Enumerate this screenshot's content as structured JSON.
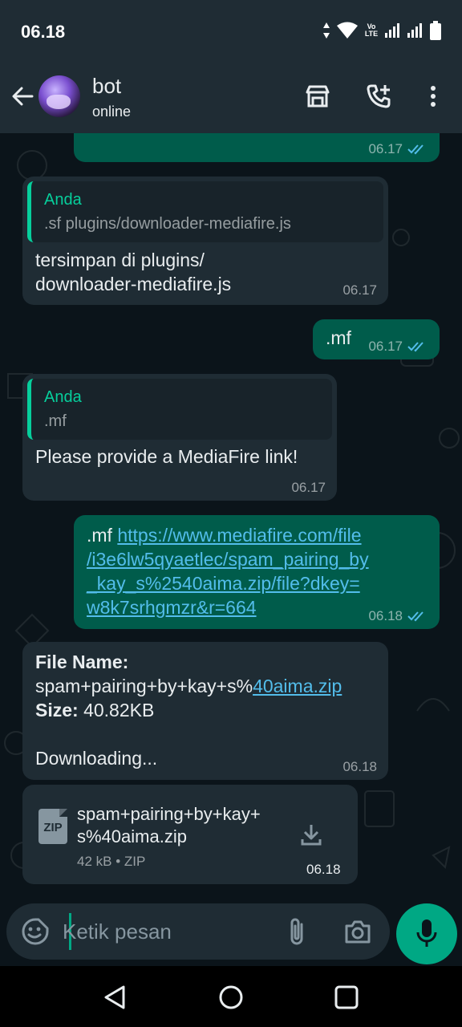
{
  "status_bar": {
    "time": "06.18",
    "volte_label": "Vo0\nLTE"
  },
  "header": {
    "name": "bot",
    "status": "online"
  },
  "messages": [
    {
      "id": "m0",
      "direction": "out",
      "time": "06.17",
      "read": true
    },
    {
      "id": "m1",
      "direction": "in",
      "quote_author": "Anda",
      "quote_text": ".sf plugins/downloader-mediafire.js",
      "lines": [
        "tersimpan di plugins/",
        "downloader-mediafire.js"
      ],
      "time": "06.17"
    },
    {
      "id": "m2",
      "direction": "out",
      "text": ".mf",
      "time": "06.17",
      "read": true
    },
    {
      "id": "m3",
      "direction": "in",
      "quote_author": "Anda",
      "quote_text": ".mf",
      "text": "Please provide a MediaFire link!",
      "time": "06.17"
    },
    {
      "id": "m4",
      "direction": "out",
      "prefix": ".mf ",
      "link_lines": [
        "https://www.mediafire.com/file",
        "/i3e6lw5qyaetlec/spam_pairing_by",
        "_kay_s%2540aima.zip/file?dkey=",
        "w8k7srhgmzr&r=664"
      ],
      "time": "06.18",
      "read": true
    },
    {
      "id": "m5",
      "direction": "in",
      "file_name_label": "File Name:",
      "file_name_plain": "spam+pairing+by+kay+s%",
      "file_name_link": "40aima.zip",
      "size_label": "Size:",
      "size_value": " 40.82KB",
      "status_text": "Downloading...",
      "time": "06.18"
    },
    {
      "id": "m6",
      "direction": "in",
      "type": "file",
      "icon_label": "ZIP",
      "file_lines": [
        "spam+pairing+by+kay+",
        "s%40aima.zip"
      ],
      "meta": "42 kB • ZIP",
      "time": "06.18"
    }
  ],
  "composer": {
    "placeholder": "Ketik pesan"
  },
  "colors": {
    "outgoing_bubble": "#005c4b",
    "incoming_bubble": "#1f2c34",
    "accent": "#00a884",
    "link": "#53bdeb",
    "read_ticks": "#53bdeb"
  }
}
